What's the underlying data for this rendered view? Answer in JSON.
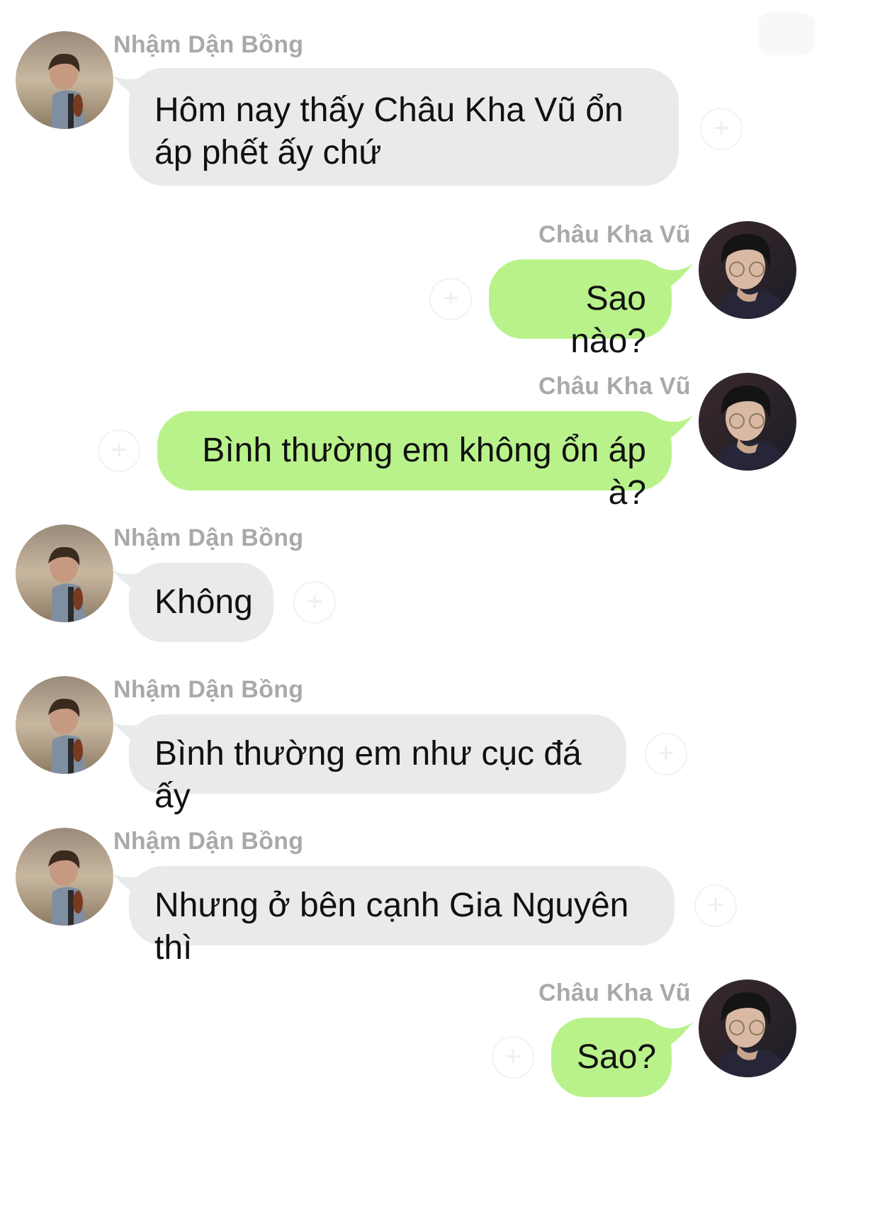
{
  "conversation": {
    "messages": [
      {
        "sender": "Nhậm Dận Bồng",
        "text": "Hôm nay thấy Châu Kha Vũ ổn áp phết ấy chứ",
        "side": "incoming"
      },
      {
        "sender": "Châu Kha Vũ",
        "text": "Sao nào?",
        "side": "outgoing"
      },
      {
        "sender": "Châu Kha Vũ",
        "text": "Bình thường em không ổn áp à?",
        "side": "outgoing"
      },
      {
        "sender": "Nhậm Dận Bồng",
        "text": "Không",
        "side": "incoming"
      },
      {
        "sender": "Nhậm Dận Bồng",
        "text": "Bình thường em như cục đá ấy",
        "side": "incoming"
      },
      {
        "sender": "Nhậm Dận Bồng",
        "text": "Nhưng ở bên cạnh Gia Nguyên thì",
        "side": "incoming"
      },
      {
        "sender": "Châu Kha Vũ",
        "text": "Sao?",
        "side": "outgoing"
      }
    ]
  },
  "icons": {
    "reaction": "add-reaction-icon",
    "avatar_incoming": "avatar-nham-dan-bong",
    "avatar_outgoing": "avatar-chau-kha-vu"
  },
  "colors": {
    "incoming_bubble": "#e9eaec",
    "outgoing_bubble": "#b9f28a",
    "sender_name": "#a9a9a9",
    "message_text": "#111111",
    "background": "#ffffff"
  }
}
